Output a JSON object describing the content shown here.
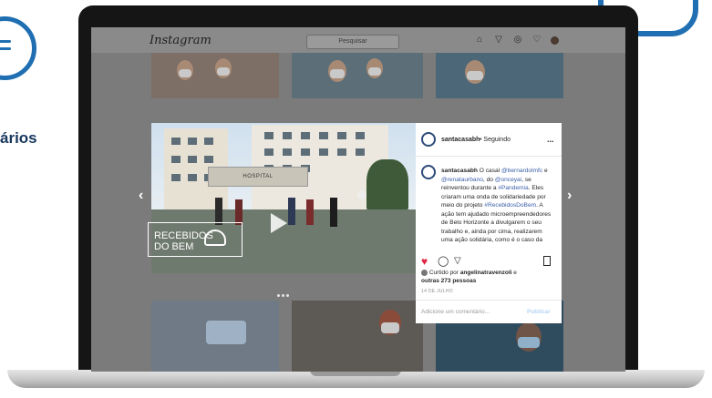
{
  "side_text": "ários",
  "instagram": {
    "logo": "Instagram",
    "search_placeholder": "Pesquisar",
    "nav_icons": [
      "home-icon",
      "send-icon",
      "explore-icon",
      "heart-icon",
      "profile-avatar"
    ]
  },
  "video": {
    "overlay_text_line1": "RECEBIDOS",
    "overlay_text_line2": "DO BEM",
    "building_sign": "HOSPITAL"
  },
  "post": {
    "username": "santacasabh",
    "follow_label": "• Seguindo",
    "more_label": "...",
    "caption_user": "santacasabh",
    "caption_text_1": " O casal ",
    "mention_1": "@bernardolmfc",
    "caption_text_2": " e ",
    "mention_2": "@renataurbano",
    "caption_text_3": ", do ",
    "mention_3": "@onceyai",
    "caption_text_4": ", se reinventou durante a ",
    "hashtag_1": "#Pandemia",
    "caption_text_5": ". Eles criaram uma onda de solidariedade por meio do projeto ",
    "hashtag_2": "#RecebidosDoBem",
    "caption_text_6": ". A ação tem ajudado microempreendedores de Belo Horizonte a divulgarem o seu trabalho e, ainda por cima, realizarem uma ação solidária, como é o caso da",
    "liked_prefix": "Curtido por ",
    "liked_by": "angelinatravenzoli",
    "liked_and": " e",
    "others": "outras 273 pessoas",
    "time": "14 DE JULHO",
    "comment_placeholder": "Adicione um comentário...",
    "publish_label": "Publicar"
  },
  "colors": {
    "accent": "#1f6fb2",
    "like_red": "#e0243f",
    "link_blue": "#3a5fa8"
  }
}
